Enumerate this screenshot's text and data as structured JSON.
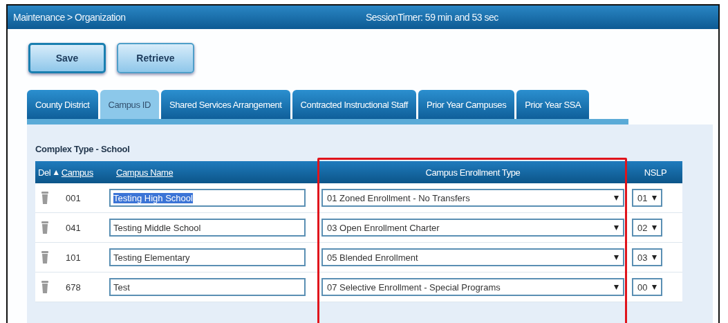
{
  "header": {
    "breadcrumb": "Maintenance > Organization",
    "session_timer": "SessionTimer: 59 min and 53 sec"
  },
  "buttons": [
    {
      "label": "Save",
      "focused": true
    },
    {
      "label": "Retrieve",
      "focused": false
    }
  ],
  "tabs": [
    {
      "label": "County District",
      "selected": false
    },
    {
      "label": "Campus ID",
      "selected": true
    },
    {
      "label": "Shared Services Arrangement",
      "selected": false
    },
    {
      "label": "Contracted Instructional Staff",
      "selected": false
    },
    {
      "label": "Prior Year Campuses",
      "selected": false
    },
    {
      "label": "Prior Year SSA",
      "selected": false
    }
  ],
  "section_title": "Complex Type - School",
  "table": {
    "columns": {
      "del": "Del",
      "sort_arrow": "▲",
      "campus": "Campus",
      "campus_name": "Campus Name",
      "enrollment_type": "Campus Enrollment Type",
      "nslp": "NSLP"
    },
    "rows": [
      {
        "campus": "001",
        "campus_name": "Testing High School",
        "text_selected": true,
        "enrollment_type": "01 Zoned Enrollment - No Transfers",
        "nslp": "01"
      },
      {
        "campus": "041",
        "campus_name": "Testing Middle School",
        "text_selected": false,
        "enrollment_type": "03 Open Enrollment Charter",
        "nslp": "02"
      },
      {
        "campus": "101",
        "campus_name": "Testing Elementary",
        "text_selected": false,
        "enrollment_type": "05 Blended Enrollment",
        "nslp": "03"
      },
      {
        "campus": "678",
        "campus_name": "Test",
        "text_selected": false,
        "enrollment_type": "07 Selective Enrollment - Special Programs",
        "nslp": "00"
      }
    ]
  },
  "highlight": {
    "on": true
  }
}
